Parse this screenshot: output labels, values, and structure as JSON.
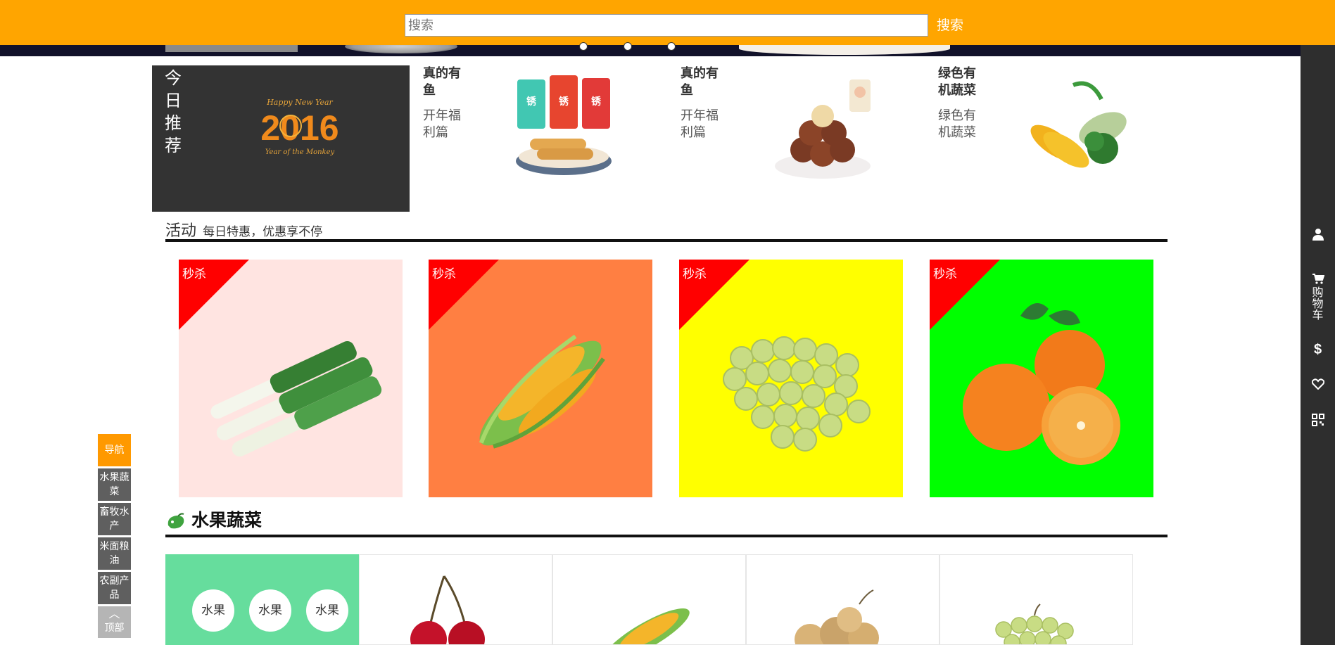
{
  "search": {
    "placeholder": "搜索",
    "button_label": "搜索"
  },
  "carousel": {
    "dots": 3
  },
  "today": {
    "title": "今日推荐",
    "image_caption_top": "Happy New Year",
    "image_year": "2016",
    "image_caption_bottom": "Year of the Monkey"
  },
  "recommendations": [
    {
      "title": "真的有鱼",
      "subtitle": "开年福利篇",
      "image": "snack-sausage-packs"
    },
    {
      "title": "真的有鱼",
      "subtitle": "开年福利篇",
      "image": "macadamia-nuts"
    },
    {
      "title": "绿色有机蔬菜",
      "subtitle": "绿色有机蔬菜",
      "image": "corn-broccoli-vegetables"
    }
  ],
  "activity": {
    "title": "活动",
    "description": "每日特惠，优惠享不停"
  },
  "flash_sales": [
    {
      "badge": "秒杀",
      "item": "leek",
      "bg": "#FFE4E1"
    },
    {
      "badge": "秒杀",
      "item": "corn",
      "bg": "#FF7F42"
    },
    {
      "badge": "秒杀",
      "item": "grapes",
      "bg": "#FFFF00"
    },
    {
      "badge": "秒杀",
      "item": "oranges",
      "bg": "#00FF00"
    }
  ],
  "fruit_veg": {
    "title": "水果蔬菜",
    "tags": [
      "水果",
      "水果",
      "水果"
    ],
    "products": [
      "cherry",
      "corn",
      "longan",
      "grapes"
    ]
  },
  "left_nav": {
    "nav": "导航",
    "items": [
      "水果蔬菜",
      "畜牧水产",
      "米面粮油",
      "农副产品"
    ],
    "top": "顶部"
  },
  "right_sidebar": {
    "user_icon": "user-icon",
    "cart_label": "购物车",
    "dollar_icon": "dollar-icon",
    "heart_icon": "heart-icon",
    "qr_icon": "qrcode-icon"
  },
  "colors": {
    "accent": "#FFA500",
    "sidebar": "#2E2E2E",
    "sale_badge": "#FF0000",
    "fruit_panel": "#66DD9D"
  }
}
